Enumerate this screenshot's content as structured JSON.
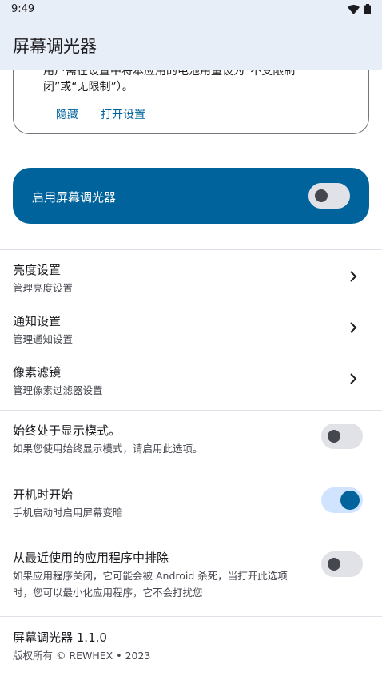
{
  "status_bar": {
    "time": "9:49"
  },
  "app_bar": {
    "title": "屏幕调光器"
  },
  "info_card": {
    "text_line_1": "用户需在设置中将本应用的电池用量设为“不受限制”",
    "text_line_2": "闭”或“无限制”）。",
    "hide_label": "隐藏",
    "open_settings_label": "打开设置"
  },
  "main_switch": {
    "label": "启用屏幕调光器",
    "enabled": false
  },
  "settings_nav": [
    {
      "title": "亮度设置",
      "subtitle": "管理亮度设置"
    },
    {
      "title": "通知设置",
      "subtitle": "管理通知设置"
    },
    {
      "title": "像素滤镜",
      "subtitle": "管理像素过滤器设置"
    }
  ],
  "toggles": {
    "always_on": {
      "title": "始终处于显示模式。",
      "subtitle": "如果您使用始终显示模式，请启用此选项。",
      "enabled": false
    },
    "start_on_boot": {
      "title": "开机时开始",
      "subtitle": "手机启动时启用屏幕变暗",
      "enabled": true
    },
    "exclude_recents": {
      "title": "从最近使用的应用程序中排除",
      "subtitle_line_1": "如果应用程序关闭，它可能会被 Android 杀死，当打开此选项",
      "subtitle_line_2": "时，您可以最小化应用程序，它不会打扰您",
      "enabled": false
    }
  },
  "footer": {
    "app_version": "屏幕调光器 1.1.0",
    "copyright": "版权所有 © REWHEX • 2023"
  },
  "colors": {
    "primary": "#00639b",
    "top_bar": "#e8eef7",
    "toggle_off_track": "#e1e2e8",
    "toggle_on_track": "#d1e4ff"
  }
}
